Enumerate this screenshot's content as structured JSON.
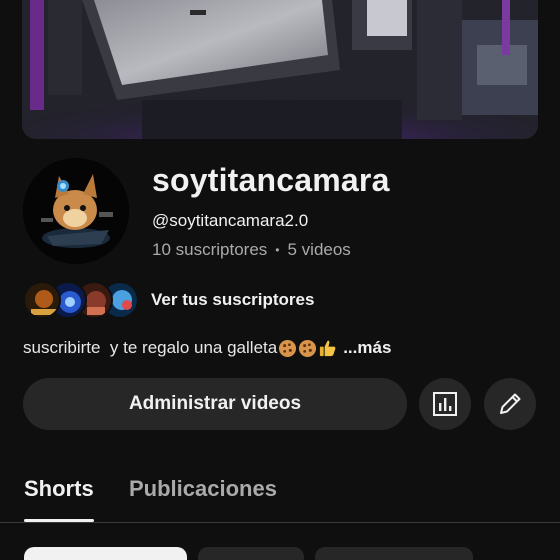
{
  "channel": {
    "name": "soytitancamara",
    "handle": "@soytitancamara2.0",
    "subscribers": "10 suscriptores",
    "separator": "•",
    "videos": "5 videos"
  },
  "subscribers_row": {
    "link_label": "Ver tus suscriptores"
  },
  "description": {
    "text": "suscribirte  y te regalo una galleta",
    "emojis": [
      "cookie-emoji",
      "cookie-emoji",
      "thumbs-up-emoji"
    ],
    "more_label": "...más"
  },
  "actions": {
    "manage_label": "Administrar videos",
    "analytics_icon": "analytics-icon",
    "edit_icon": "pencil-icon"
  },
  "tabs": [
    {
      "label": "Shorts",
      "selected": true
    },
    {
      "label": "Publicaciones",
      "selected": false
    }
  ],
  "colors": {
    "background": "#0f0f0f",
    "button": "#272727",
    "text": "#f1f1f1",
    "muted": "#aaaaaa"
  }
}
